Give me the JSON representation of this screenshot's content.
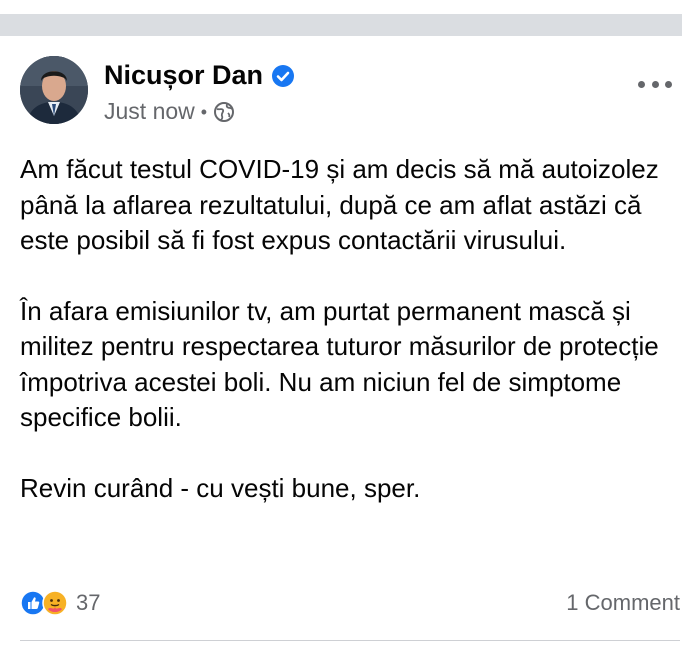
{
  "post": {
    "author": "Nicușor Dan",
    "timestamp": "Just now",
    "separator": "•",
    "privacy_icon": "globe-icon",
    "verified_icon": "verified-badge-icon",
    "paragraphs": [
      "Am făcut testul COVID-19 și am decis să mă autoizolez până la aflarea rezultatului, după ce am aflat astăzi că este posibil să fi fost expus contactării virusului.",
      "În afara emisiunilor tv, am purtat permanent mască și militez pentru respectarea tuturor măsurilor de protecție împotriva acestei boli. Nu am niciun fel de simptome specifice bolii.",
      "Revin curând - cu vești bune, sper."
    ],
    "reactions": {
      "icons": [
        "like-icon",
        "care-icon"
      ],
      "count": "37"
    },
    "comments_label": "1 Comment"
  },
  "colors": {
    "accent": "#1877f2",
    "secondary_text": "#65676b",
    "primary_text": "#050505",
    "care_yellow": "#f7b125"
  }
}
